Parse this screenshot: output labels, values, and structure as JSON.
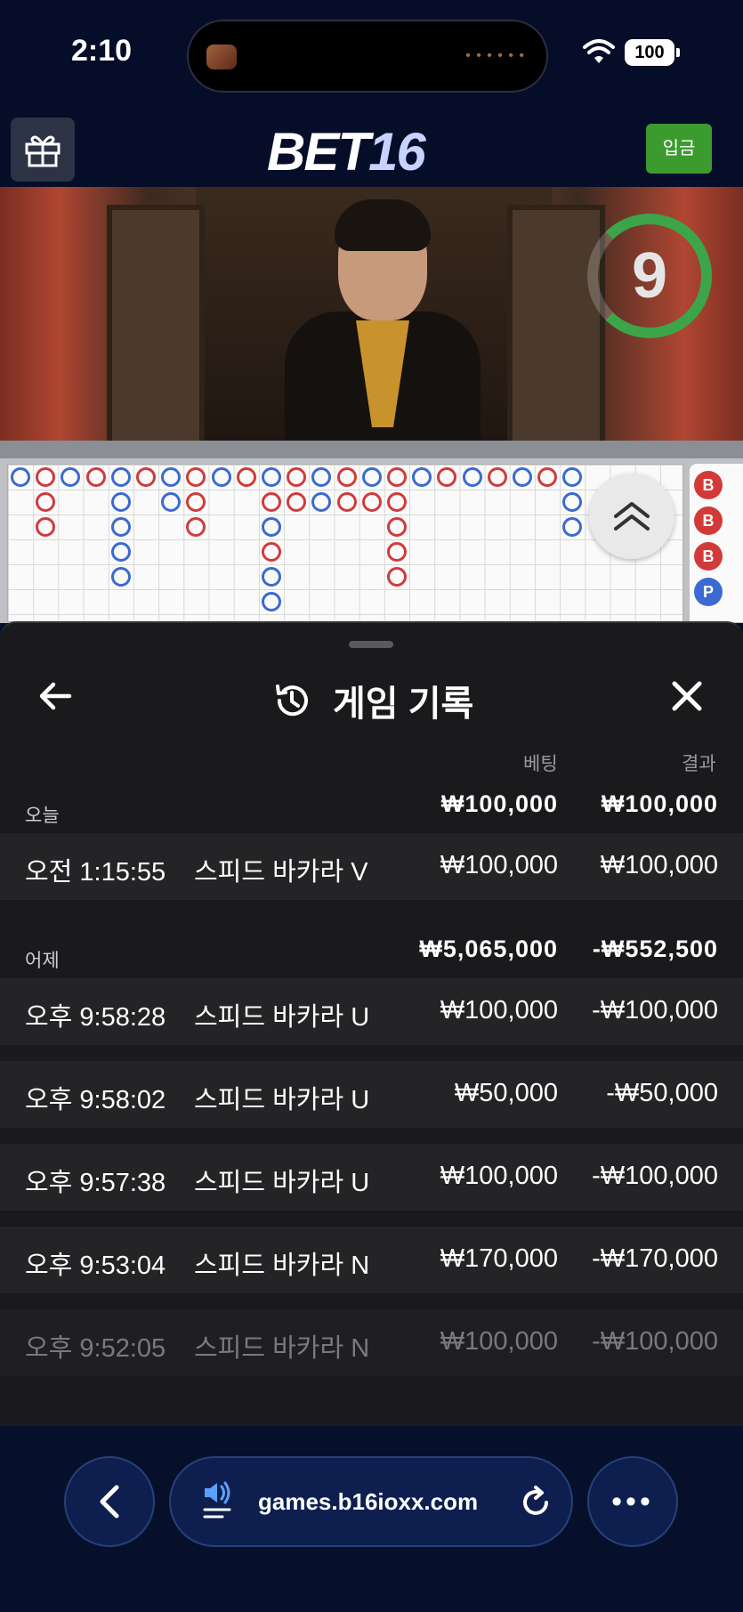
{
  "status_bar": {
    "time": "2:10",
    "battery": "100"
  },
  "header": {
    "logo_main": "BET",
    "logo_num": "16",
    "deposit_label": "입금"
  },
  "video": {
    "countdown": "9"
  },
  "road": {
    "side_beads": [
      "B",
      "B",
      "B",
      "P"
    ]
  },
  "history": {
    "title": "게임 기록",
    "col_bet": "베팅",
    "col_result": "결과",
    "groups": [
      {
        "label": "오늘",
        "bet_total": "₩100,000",
        "result_total": "₩100,000",
        "rows": [
          {
            "time": "오전 1:15:55",
            "game": "스피드 바카라 V",
            "bet": "₩100,000",
            "result": "₩100,000"
          }
        ]
      },
      {
        "label": "어제",
        "bet_total": "₩5,065,000",
        "result_total": "-₩552,500",
        "rows": [
          {
            "time": "오후 9:58:28",
            "game": "스피드 바카라 U",
            "bet": "₩100,000",
            "result": "-₩100,000"
          },
          {
            "time": "오후 9:58:02",
            "game": "스피드 바카라 U",
            "bet": "₩50,000",
            "result": "-₩50,000"
          },
          {
            "time": "오후 9:57:38",
            "game": "스피드 바카라 U",
            "bet": "₩100,000",
            "result": "-₩100,000"
          },
          {
            "time": "오후 9:53:04",
            "game": "스피드 바카라 N",
            "bet": "₩170,000",
            "result": "-₩170,000"
          },
          {
            "time": "오후 9:52:05",
            "game": "스피드 바카라 N",
            "bet": "₩100,000",
            "result": "-₩100,000"
          }
        ]
      }
    ]
  },
  "browser": {
    "url": "games.b16ioxx.com"
  },
  "colors": {
    "banker": "#d23a3a",
    "player": "#3a6ad2",
    "accent_green": "#3b9b2f",
    "sheet_bg": "#1a1a1c"
  },
  "icons": [
    "gift-icon",
    "back-arrow-icon",
    "history-icon",
    "close-icon",
    "chevron-up-icon",
    "speaker-icon",
    "reload-icon",
    "more-icon"
  ]
}
